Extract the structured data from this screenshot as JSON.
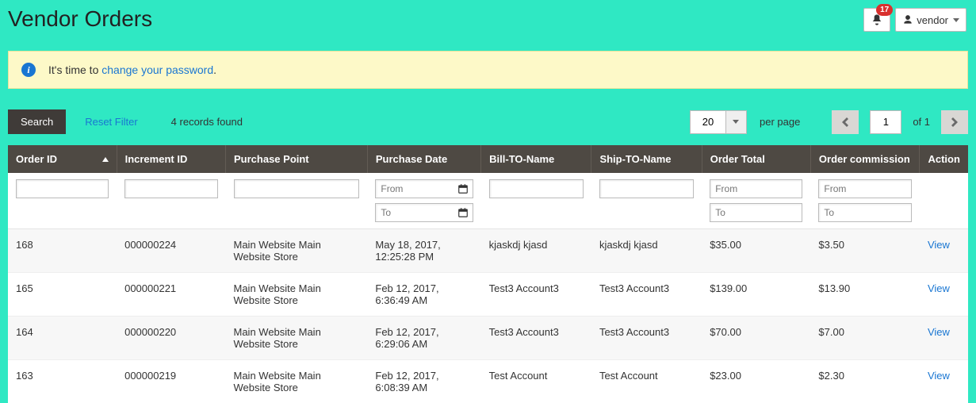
{
  "page_title": "Vendor Orders",
  "header": {
    "badge_count": "17",
    "user_label": "vendor"
  },
  "notice": {
    "prefix": "It's time to ",
    "link": "change your password",
    "suffix": "."
  },
  "toolbar": {
    "search_label": "Search",
    "reset_label": "Reset Filter",
    "records_found": "4 records found",
    "per_page_value": "20",
    "per_page_label": "per page",
    "page_value": "1",
    "of_pages": "of 1"
  },
  "columns": {
    "order_id": "Order ID",
    "increment_id": "Increment ID",
    "purchase_point": "Purchase Point",
    "purchase_date": "Purchase Date",
    "bill_to": "Bill-TO-Name",
    "ship_to": "Ship-TO-Name",
    "order_total": "Order Total",
    "commission": "Order commission",
    "action": "Action"
  },
  "filters": {
    "date_from_placeholder": "From",
    "date_to_placeholder": "To",
    "range_from_placeholder": "From",
    "range_to_placeholder": "To"
  },
  "action_label": "View",
  "rows": [
    {
      "order_id": "168",
      "increment_id": "000000224",
      "purchase_point": "Main Website Main Website Store",
      "purchase_date": "May 18, 2017, 12:25:28 PM",
      "bill_to": "kjaskdj kjasd",
      "ship_to": "kjaskdj kjasd",
      "order_total": "$35.00",
      "commission": "$3.50"
    },
    {
      "order_id": "165",
      "increment_id": "000000221",
      "purchase_point": "Main Website Main Website Store",
      "purchase_date": "Feb 12, 2017, 6:36:49 AM",
      "bill_to": "Test3 Account3",
      "ship_to": "Test3 Account3",
      "order_total": "$139.00",
      "commission": "$13.90"
    },
    {
      "order_id": "164",
      "increment_id": "000000220",
      "purchase_point": "Main Website Main Website Store",
      "purchase_date": "Feb 12, 2017, 6:29:06 AM",
      "bill_to": "Test3 Account3",
      "ship_to": "Test3 Account3",
      "order_total": "$70.00",
      "commission": "$7.00"
    },
    {
      "order_id": "163",
      "increment_id": "000000219",
      "purchase_point": "Main Website Main Website Store",
      "purchase_date": "Feb 12, 2017, 6:08:39 AM",
      "bill_to": "Test Account",
      "ship_to": "Test Account",
      "order_total": "$23.00",
      "commission": "$2.30"
    }
  ]
}
